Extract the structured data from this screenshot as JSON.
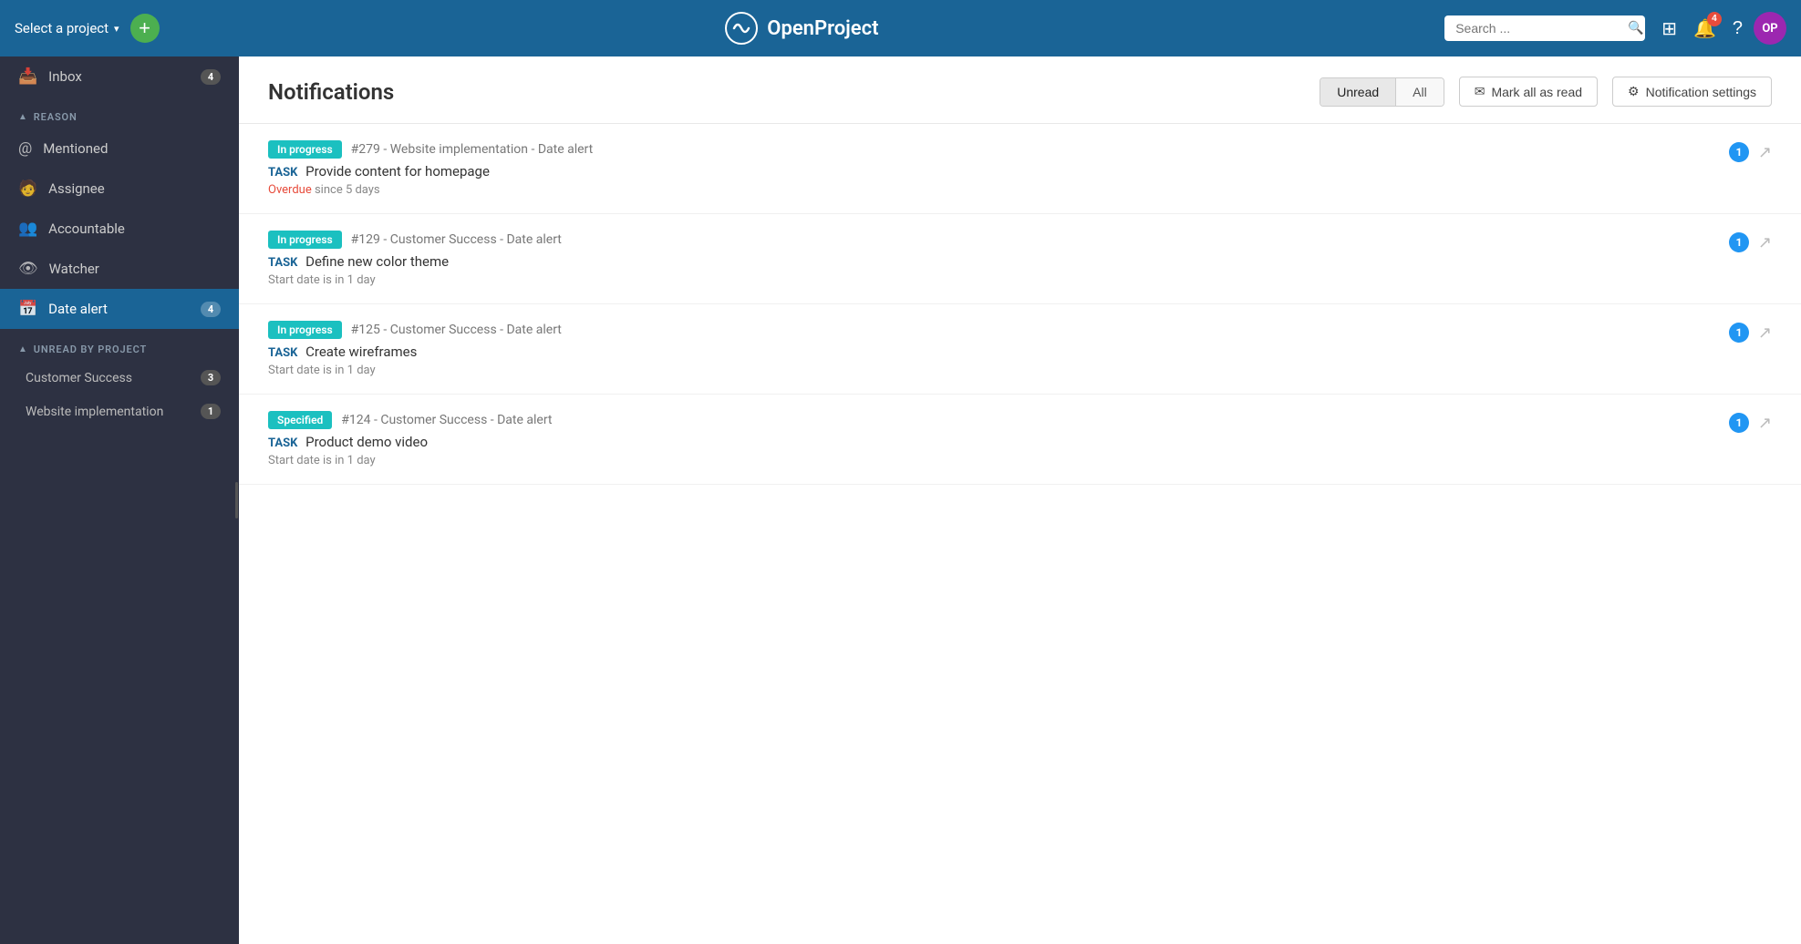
{
  "header": {
    "project_selector_label": "Select a project",
    "logo_text": "OpenProject",
    "search_placeholder": "Search ...",
    "notification_badge": "4",
    "avatar_initials": "OP"
  },
  "sidebar": {
    "reason_section_label": "REASON",
    "inbox_label": "Inbox",
    "inbox_badge": "4",
    "reason_items": [
      {
        "id": "mentioned",
        "label": "Mentioned",
        "icon": "👤"
      },
      {
        "id": "assignee",
        "label": "Assignee",
        "icon": "🧑"
      },
      {
        "id": "accountable",
        "label": "Accountable",
        "icon": "👥"
      },
      {
        "id": "watcher",
        "label": "Watcher",
        "icon": "👁"
      },
      {
        "id": "date-alert",
        "label": "Date alert",
        "icon": "📅",
        "badge": "4",
        "active": true
      }
    ],
    "unread_section_label": "UNREAD BY PROJECT",
    "project_items": [
      {
        "id": "customer-success",
        "label": "Customer Success",
        "badge": "3"
      },
      {
        "id": "website-implementation",
        "label": "Website implementation",
        "badge": "1"
      }
    ]
  },
  "notifications": {
    "title": "Notifications",
    "filter_unread": "Unread",
    "filter_all": "All",
    "mark_all_read": "Mark all as read",
    "notification_settings": "Notification settings",
    "items": [
      {
        "id": 1,
        "status": "In progress",
        "status_class": "in-progress",
        "project_ref": "#279",
        "project_name": "Website implementation",
        "reason": "Date alert",
        "task_type": "TASK",
        "task_name": "Provide content for homepage",
        "sub_type": "overdue",
        "sub_text": "Overdue since 5 days",
        "count": "1"
      },
      {
        "id": 2,
        "status": "In progress",
        "status_class": "in-progress",
        "project_ref": "#129",
        "project_name": "Customer Success",
        "reason": "Date alert",
        "task_type": "TASK",
        "task_name": "Define new color theme",
        "sub_type": "normal",
        "sub_text": "Start date is in 1 day",
        "count": "1"
      },
      {
        "id": 3,
        "status": "In progress",
        "status_class": "in-progress",
        "project_ref": "#125",
        "project_name": "Customer Success",
        "reason": "Date alert",
        "task_type": "TASK",
        "task_name": "Create wireframes",
        "sub_type": "normal",
        "sub_text": "Start date is in 1 day",
        "count": "1"
      },
      {
        "id": 4,
        "status": "Specified",
        "status_class": "specified",
        "project_ref": "#124",
        "project_name": "Customer Success",
        "reason": "Date alert",
        "task_type": "TASK",
        "task_name": "Product demo video",
        "sub_type": "normal",
        "sub_text": "Start date is in 1 day",
        "count": "1"
      }
    ]
  }
}
